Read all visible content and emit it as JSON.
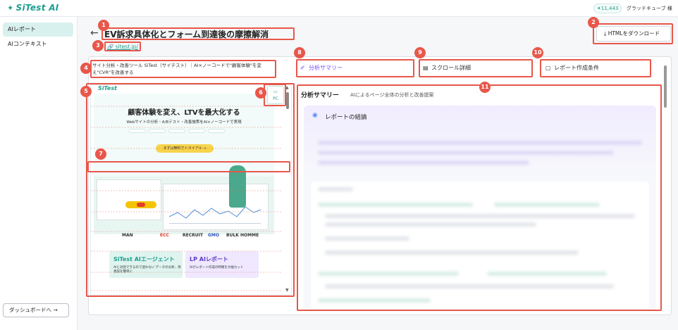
{
  "app": {
    "logo": "SiTest AI",
    "points": "11,443",
    "account": "グラッドキューブ 様"
  },
  "sidebar": {
    "items": [
      {
        "label": "AIレポート",
        "active": true
      },
      {
        "label": "AIコンテキスト",
        "active": false
      }
    ],
    "dashboard_button": "ダッシュボードへ →"
  },
  "header": {
    "title": "EV訴求具体化とフォーム到達後の摩擦解消",
    "url": "sitest.jp/",
    "download_button": "HTMLをダウンロード",
    "site_description": "サイト分析・改善ツール SiTest（サイテスト）｜AI×ノーコードで\"顧客体験\"を変え\"CVR\"を改善する"
  },
  "tabs": [
    {
      "label": "分析サマリー",
      "icon": "sparkle-icon",
      "active": true
    },
    {
      "label": "スクロール詳細",
      "icon": "chart-icon",
      "active": false
    },
    {
      "label": "レポート作成条件",
      "icon": "clipboard-icon",
      "active": false
    }
  ],
  "preview": {
    "logo": "SiTest",
    "device_label": "PC",
    "hero_title": "顧客体験を変え、LTVを最大化する",
    "hero_sub": "Webサイトの分析・A/Bテスト・改善施策をAI×ノーコードで実現",
    "cta": "まずは無料でトライアル →",
    "client_logos": [
      "MAN",
      "ECC",
      "RECRUIT",
      "GMO",
      "BULK HOMME"
    ],
    "banner1_title": "SiTest AIエージェント",
    "banner1_sub": "AIと対話できるので迷わない データの分析、改善案を簡単に",
    "banner2_title": "LP AIレポート",
    "banner2_sub": "AIがレポート作成の時間を大幅カット"
  },
  "analysis": {
    "heading": "分析サマリー",
    "subheading": "AIによるページ全体の分析と改善提案",
    "card_title": "レポートの結論"
  },
  "annotations": [
    "1",
    "2",
    "3",
    "4",
    "5",
    "6",
    "7",
    "8",
    "9",
    "10",
    "11"
  ],
  "colors": {
    "accent": "#1e9e8f",
    "annotation": "#e8574a",
    "tab_active": "#7c4dff"
  }
}
